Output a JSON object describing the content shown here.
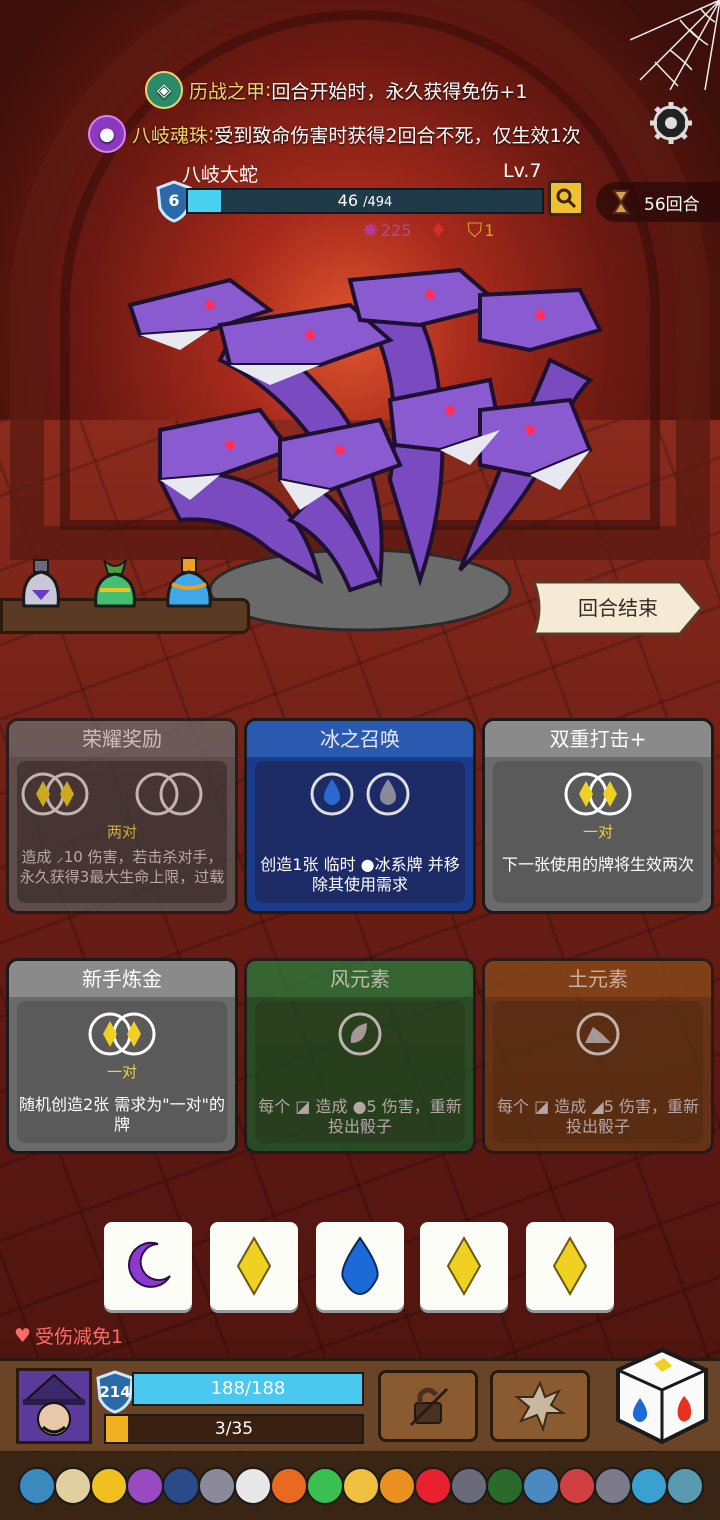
{
  "relics_info": [
    {
      "name": "历战之甲",
      "sep": ":",
      "text": "回合开始时，永久获得免伤+1",
      "icon": "armor-relic-icon"
    },
    {
      "name": "八岐魂珠",
      "sep": ":",
      "text": "受到致命伤害时获得2回合不死，仅生效1次",
      "icon": "soul-orb-relic-icon"
    }
  ],
  "enemy": {
    "name": "八岐大蛇",
    "level": "Lv.7",
    "shield": "6",
    "hp_current": "46",
    "hp_max": "/494",
    "hp_fraction": 0.093,
    "intents": [
      {
        "icon": "purple-splat-icon",
        "value": "225"
      },
      {
        "icon": "fire-drop-icon",
        "value": ""
      },
      {
        "icon": "shield-icon",
        "value": "1"
      }
    ]
  },
  "rounds_label": "56回合",
  "end_turn_label": "回合结束",
  "cards": [
    {
      "title": "荣耀奖励",
      "req_label": "两对",
      "desc": "造成 ⸝10 伤害，若击杀对手，永久获得3最大生命上限，过载",
      "theme": "gray",
      "dim": true
    },
    {
      "title": "冰之召唤",
      "req_label": "",
      "desc": "创造1张 临时 ●冰系牌 并移除其使用需求",
      "theme": "blue",
      "dim": false
    },
    {
      "title": "双重打击+",
      "req_label": "一对",
      "desc": "下一张使用的牌将生效两次",
      "theme": "gray",
      "dim": false
    },
    {
      "title": "新手炼金",
      "req_label": "一对",
      "desc": "随机创造2张 需求为\"一对\"的牌",
      "theme": "gray",
      "dim": false
    },
    {
      "title": "风元素",
      "req_label": "",
      "desc": "每个 ◪ 造成 ●5 伤害，重新投出骰子",
      "theme": "green",
      "dim": true
    },
    {
      "title": "土元素",
      "req_label": "",
      "desc": "每个 ◪ 造成 ◢5 伤害，重新投出骰子",
      "theme": "brown",
      "dim": true
    }
  ],
  "dice_pool": [
    "moon",
    "diamond",
    "drop",
    "diamond",
    "diamond"
  ],
  "damage_reduction": "受伤减免1",
  "player": {
    "shield": "214",
    "hp": "188/188",
    "xp": "3/35",
    "xp_fraction": 0.086
  },
  "colors": {
    "accent": "#f4d46a",
    "hp": "#4ad0f0",
    "danger": "#ff6a6a"
  }
}
